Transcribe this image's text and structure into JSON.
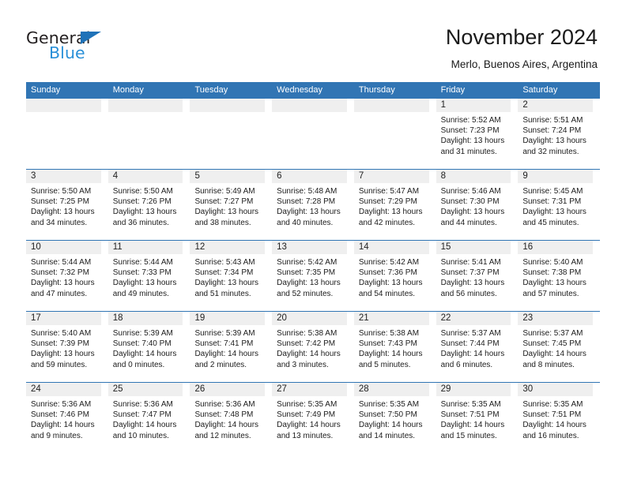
{
  "logo": {
    "word_top": "General",
    "word_bottom": "Blue",
    "triangle_icon": "triangle-icon",
    "blue": "#2a90d8",
    "dark": "#231f20"
  },
  "header": {
    "title": "November 2024",
    "subtitle": "Merlo, Buenos Aires, Argentina"
  },
  "theme": {
    "header_blue": "#3175b4",
    "daynum_band": "#efefef",
    "text": "#1c1c1c"
  },
  "calendar": {
    "weekdays": [
      "Sunday",
      "Monday",
      "Tuesday",
      "Wednesday",
      "Thursday",
      "Friday",
      "Saturday"
    ],
    "weeks": [
      [
        {
          "day": "",
          "lines": []
        },
        {
          "day": "",
          "lines": []
        },
        {
          "day": "",
          "lines": []
        },
        {
          "day": "",
          "lines": []
        },
        {
          "day": "",
          "lines": []
        },
        {
          "day": "1",
          "lines": [
            "Sunrise: 5:52 AM",
            "Sunset: 7:23 PM",
            "Daylight: 13 hours",
            "and 31 minutes."
          ]
        },
        {
          "day": "2",
          "lines": [
            "Sunrise: 5:51 AM",
            "Sunset: 7:24 PM",
            "Daylight: 13 hours",
            "and 32 minutes."
          ]
        }
      ],
      [
        {
          "day": "3",
          "lines": [
            "Sunrise: 5:50 AM",
            "Sunset: 7:25 PM",
            "Daylight: 13 hours",
            "and 34 minutes."
          ]
        },
        {
          "day": "4",
          "lines": [
            "Sunrise: 5:50 AM",
            "Sunset: 7:26 PM",
            "Daylight: 13 hours",
            "and 36 minutes."
          ]
        },
        {
          "day": "5",
          "lines": [
            "Sunrise: 5:49 AM",
            "Sunset: 7:27 PM",
            "Daylight: 13 hours",
            "and 38 minutes."
          ]
        },
        {
          "day": "6",
          "lines": [
            "Sunrise: 5:48 AM",
            "Sunset: 7:28 PM",
            "Daylight: 13 hours",
            "and 40 minutes."
          ]
        },
        {
          "day": "7",
          "lines": [
            "Sunrise: 5:47 AM",
            "Sunset: 7:29 PM",
            "Daylight: 13 hours",
            "and 42 minutes."
          ]
        },
        {
          "day": "8",
          "lines": [
            "Sunrise: 5:46 AM",
            "Sunset: 7:30 PM",
            "Daylight: 13 hours",
            "and 44 minutes."
          ]
        },
        {
          "day": "9",
          "lines": [
            "Sunrise: 5:45 AM",
            "Sunset: 7:31 PM",
            "Daylight: 13 hours",
            "and 45 minutes."
          ]
        }
      ],
      [
        {
          "day": "10",
          "lines": [
            "Sunrise: 5:44 AM",
            "Sunset: 7:32 PM",
            "Daylight: 13 hours",
            "and 47 minutes."
          ]
        },
        {
          "day": "11",
          "lines": [
            "Sunrise: 5:44 AM",
            "Sunset: 7:33 PM",
            "Daylight: 13 hours",
            "and 49 minutes."
          ]
        },
        {
          "day": "12",
          "lines": [
            "Sunrise: 5:43 AM",
            "Sunset: 7:34 PM",
            "Daylight: 13 hours",
            "and 51 minutes."
          ]
        },
        {
          "day": "13",
          "lines": [
            "Sunrise: 5:42 AM",
            "Sunset: 7:35 PM",
            "Daylight: 13 hours",
            "and 52 minutes."
          ]
        },
        {
          "day": "14",
          "lines": [
            "Sunrise: 5:42 AM",
            "Sunset: 7:36 PM",
            "Daylight: 13 hours",
            "and 54 minutes."
          ]
        },
        {
          "day": "15",
          "lines": [
            "Sunrise: 5:41 AM",
            "Sunset: 7:37 PM",
            "Daylight: 13 hours",
            "and 56 minutes."
          ]
        },
        {
          "day": "16",
          "lines": [
            "Sunrise: 5:40 AM",
            "Sunset: 7:38 PM",
            "Daylight: 13 hours",
            "and 57 minutes."
          ]
        }
      ],
      [
        {
          "day": "17",
          "lines": [
            "Sunrise: 5:40 AM",
            "Sunset: 7:39 PM",
            "Daylight: 13 hours",
            "and 59 minutes."
          ]
        },
        {
          "day": "18",
          "lines": [
            "Sunrise: 5:39 AM",
            "Sunset: 7:40 PM",
            "Daylight: 14 hours",
            "and 0 minutes."
          ]
        },
        {
          "day": "19",
          "lines": [
            "Sunrise: 5:39 AM",
            "Sunset: 7:41 PM",
            "Daylight: 14 hours",
            "and 2 minutes."
          ]
        },
        {
          "day": "20",
          "lines": [
            "Sunrise: 5:38 AM",
            "Sunset: 7:42 PM",
            "Daylight: 14 hours",
            "and 3 minutes."
          ]
        },
        {
          "day": "21",
          "lines": [
            "Sunrise: 5:38 AM",
            "Sunset: 7:43 PM",
            "Daylight: 14 hours",
            "and 5 minutes."
          ]
        },
        {
          "day": "22",
          "lines": [
            "Sunrise: 5:37 AM",
            "Sunset: 7:44 PM",
            "Daylight: 14 hours",
            "and 6 minutes."
          ]
        },
        {
          "day": "23",
          "lines": [
            "Sunrise: 5:37 AM",
            "Sunset: 7:45 PM",
            "Daylight: 14 hours",
            "and 8 minutes."
          ]
        }
      ],
      [
        {
          "day": "24",
          "lines": [
            "Sunrise: 5:36 AM",
            "Sunset: 7:46 PM",
            "Daylight: 14 hours",
            "and 9 minutes."
          ]
        },
        {
          "day": "25",
          "lines": [
            "Sunrise: 5:36 AM",
            "Sunset: 7:47 PM",
            "Daylight: 14 hours",
            "and 10 minutes."
          ]
        },
        {
          "day": "26",
          "lines": [
            "Sunrise: 5:36 AM",
            "Sunset: 7:48 PM",
            "Daylight: 14 hours",
            "and 12 minutes."
          ]
        },
        {
          "day": "27",
          "lines": [
            "Sunrise: 5:35 AM",
            "Sunset: 7:49 PM",
            "Daylight: 14 hours",
            "and 13 minutes."
          ]
        },
        {
          "day": "28",
          "lines": [
            "Sunrise: 5:35 AM",
            "Sunset: 7:50 PM",
            "Daylight: 14 hours",
            "and 14 minutes."
          ]
        },
        {
          "day": "29",
          "lines": [
            "Sunrise: 5:35 AM",
            "Sunset: 7:51 PM",
            "Daylight: 14 hours",
            "and 15 minutes."
          ]
        },
        {
          "day": "30",
          "lines": [
            "Sunrise: 5:35 AM",
            "Sunset: 7:51 PM",
            "Daylight: 14 hours",
            "and 16 minutes."
          ]
        }
      ]
    ]
  }
}
